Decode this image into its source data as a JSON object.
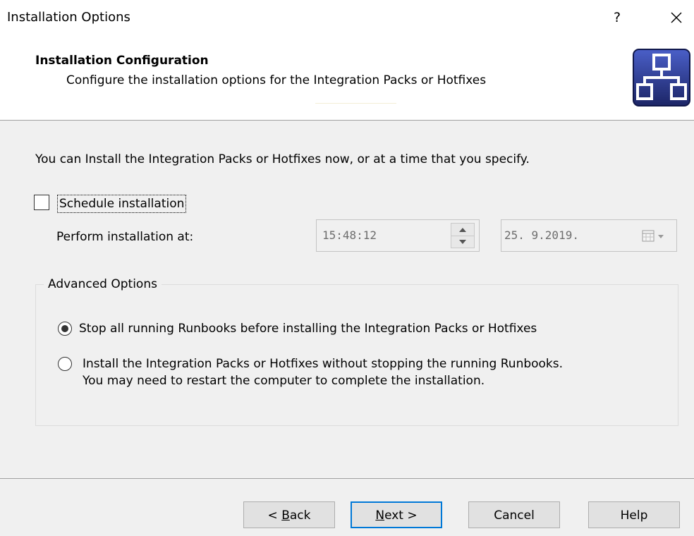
{
  "window": {
    "title": "Installation Options",
    "help_label": "?",
    "close_label": "✕"
  },
  "header": {
    "title": "Installation Configuration",
    "subtitle": "Configure the installation options for the Integration Packs or Hotfixes",
    "icon": "network-hierarchy-icon"
  },
  "main": {
    "intro": "You can Install the Integration Packs or Hotfixes now, or at a time that you specify.",
    "schedule": {
      "label": "Schedule installation",
      "checked": false
    },
    "perform_label": "Perform installation at:",
    "time_value": "15:48:12",
    "date_value": "25.  9.2019."
  },
  "advanced": {
    "legend": "Advanced Options",
    "option1": {
      "label": "Stop all running Runbooks before installing the Integration Packs or Hotfixes",
      "selected": true
    },
    "option2": {
      "line1": "Install the Integration Packs or Hotfixes without stopping the running Runbooks.",
      "line2": "You may need to restart the computer to complete the installation.",
      "selected": false
    }
  },
  "footer": {
    "back": {
      "prefix": "< ",
      "mnemonic": "B",
      "rest": "ack"
    },
    "next": {
      "mnemonic": "N",
      "rest": "ext >"
    },
    "cancel": "Cancel",
    "help": "Help"
  },
  "colors": {
    "accent": "#0078d7",
    "icon_bg": "#2b3a8c"
  }
}
